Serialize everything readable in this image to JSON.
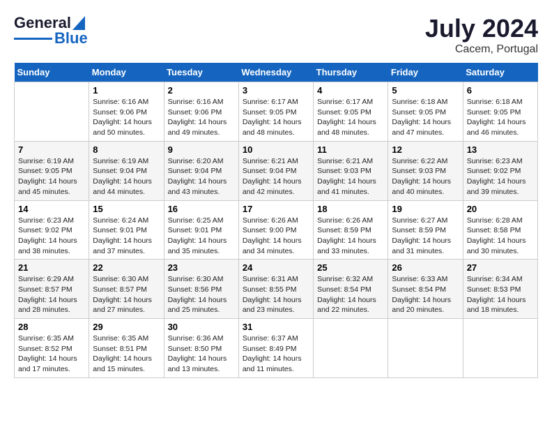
{
  "header": {
    "logo_line1": "General",
    "logo_line2": "Blue",
    "month_year": "July 2024",
    "location": "Cacem, Portugal"
  },
  "columns": [
    "Sunday",
    "Monday",
    "Tuesday",
    "Wednesday",
    "Thursday",
    "Friday",
    "Saturday"
  ],
  "weeks": [
    [
      {
        "day": "",
        "info": ""
      },
      {
        "day": "1",
        "info": "Sunrise: 6:16 AM\nSunset: 9:06 PM\nDaylight: 14 hours\nand 50 minutes."
      },
      {
        "day": "2",
        "info": "Sunrise: 6:16 AM\nSunset: 9:06 PM\nDaylight: 14 hours\nand 49 minutes."
      },
      {
        "day": "3",
        "info": "Sunrise: 6:17 AM\nSunset: 9:05 PM\nDaylight: 14 hours\nand 48 minutes."
      },
      {
        "day": "4",
        "info": "Sunrise: 6:17 AM\nSunset: 9:05 PM\nDaylight: 14 hours\nand 48 minutes."
      },
      {
        "day": "5",
        "info": "Sunrise: 6:18 AM\nSunset: 9:05 PM\nDaylight: 14 hours\nand 47 minutes."
      },
      {
        "day": "6",
        "info": "Sunrise: 6:18 AM\nSunset: 9:05 PM\nDaylight: 14 hours\nand 46 minutes."
      }
    ],
    [
      {
        "day": "7",
        "info": "Sunrise: 6:19 AM\nSunset: 9:05 PM\nDaylight: 14 hours\nand 45 minutes."
      },
      {
        "day": "8",
        "info": "Sunrise: 6:19 AM\nSunset: 9:04 PM\nDaylight: 14 hours\nand 44 minutes."
      },
      {
        "day": "9",
        "info": "Sunrise: 6:20 AM\nSunset: 9:04 PM\nDaylight: 14 hours\nand 43 minutes."
      },
      {
        "day": "10",
        "info": "Sunrise: 6:21 AM\nSunset: 9:04 PM\nDaylight: 14 hours\nand 42 minutes."
      },
      {
        "day": "11",
        "info": "Sunrise: 6:21 AM\nSunset: 9:03 PM\nDaylight: 14 hours\nand 41 minutes."
      },
      {
        "day": "12",
        "info": "Sunrise: 6:22 AM\nSunset: 9:03 PM\nDaylight: 14 hours\nand 40 minutes."
      },
      {
        "day": "13",
        "info": "Sunrise: 6:23 AM\nSunset: 9:02 PM\nDaylight: 14 hours\nand 39 minutes."
      }
    ],
    [
      {
        "day": "14",
        "info": "Sunrise: 6:23 AM\nSunset: 9:02 PM\nDaylight: 14 hours\nand 38 minutes."
      },
      {
        "day": "15",
        "info": "Sunrise: 6:24 AM\nSunset: 9:01 PM\nDaylight: 14 hours\nand 37 minutes."
      },
      {
        "day": "16",
        "info": "Sunrise: 6:25 AM\nSunset: 9:01 PM\nDaylight: 14 hours\nand 35 minutes."
      },
      {
        "day": "17",
        "info": "Sunrise: 6:26 AM\nSunset: 9:00 PM\nDaylight: 14 hours\nand 34 minutes."
      },
      {
        "day": "18",
        "info": "Sunrise: 6:26 AM\nSunset: 8:59 PM\nDaylight: 14 hours\nand 33 minutes."
      },
      {
        "day": "19",
        "info": "Sunrise: 6:27 AM\nSunset: 8:59 PM\nDaylight: 14 hours\nand 31 minutes."
      },
      {
        "day": "20",
        "info": "Sunrise: 6:28 AM\nSunset: 8:58 PM\nDaylight: 14 hours\nand 30 minutes."
      }
    ],
    [
      {
        "day": "21",
        "info": "Sunrise: 6:29 AM\nSunset: 8:57 PM\nDaylight: 14 hours\nand 28 minutes."
      },
      {
        "day": "22",
        "info": "Sunrise: 6:30 AM\nSunset: 8:57 PM\nDaylight: 14 hours\nand 27 minutes."
      },
      {
        "day": "23",
        "info": "Sunrise: 6:30 AM\nSunset: 8:56 PM\nDaylight: 14 hours\nand 25 minutes."
      },
      {
        "day": "24",
        "info": "Sunrise: 6:31 AM\nSunset: 8:55 PM\nDaylight: 14 hours\nand 23 minutes."
      },
      {
        "day": "25",
        "info": "Sunrise: 6:32 AM\nSunset: 8:54 PM\nDaylight: 14 hours\nand 22 minutes."
      },
      {
        "day": "26",
        "info": "Sunrise: 6:33 AM\nSunset: 8:54 PM\nDaylight: 14 hours\nand 20 minutes."
      },
      {
        "day": "27",
        "info": "Sunrise: 6:34 AM\nSunset: 8:53 PM\nDaylight: 14 hours\nand 18 minutes."
      }
    ],
    [
      {
        "day": "28",
        "info": "Sunrise: 6:35 AM\nSunset: 8:52 PM\nDaylight: 14 hours\nand 17 minutes."
      },
      {
        "day": "29",
        "info": "Sunrise: 6:35 AM\nSunset: 8:51 PM\nDaylight: 14 hours\nand 15 minutes."
      },
      {
        "day": "30",
        "info": "Sunrise: 6:36 AM\nSunset: 8:50 PM\nDaylight: 14 hours\nand 13 minutes."
      },
      {
        "day": "31",
        "info": "Sunrise: 6:37 AM\nSunset: 8:49 PM\nDaylight: 14 hours\nand 11 minutes."
      },
      {
        "day": "",
        "info": ""
      },
      {
        "day": "",
        "info": ""
      },
      {
        "day": "",
        "info": ""
      }
    ]
  ]
}
